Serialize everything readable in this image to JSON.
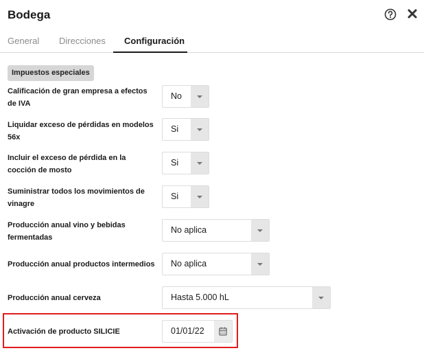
{
  "header": {
    "title": "Bodega",
    "help_icon": "help-circle-icon",
    "close_icon": "close-icon"
  },
  "tabs": [
    {
      "label": "General",
      "active": false
    },
    {
      "label": "Direcciones",
      "active": false
    },
    {
      "label": "Configuración",
      "active": true
    }
  ],
  "section": {
    "title": "Impuestos especiales"
  },
  "fields": [
    {
      "label": "Calificación de gran empresa a efectos de IVA",
      "value": "No"
    },
    {
      "label": "Liquidar exceso de pérdidas en modelos 56x",
      "value": "Si"
    },
    {
      "label": "Incluir el exceso de pérdida en la cocción de mosto",
      "value": "Si"
    },
    {
      "label": "Suministrar todos los movimientos de vinagre",
      "value": "Si"
    },
    {
      "label": "Producción anual vino y bebidas fermentadas",
      "value": "No aplica"
    },
    {
      "label": "Producción anual productos intermedios",
      "value": "No aplica"
    },
    {
      "label": "Producción anual cerveza",
      "value": "Hasta 5.000 hL"
    }
  ],
  "date_field": {
    "label": "Activación de producto SILICIE",
    "value": "01/01/22",
    "icon": "calendar-icon"
  },
  "colors": {
    "highlight_border": "#e01b1b",
    "chip_background": "#d6d6d6"
  }
}
